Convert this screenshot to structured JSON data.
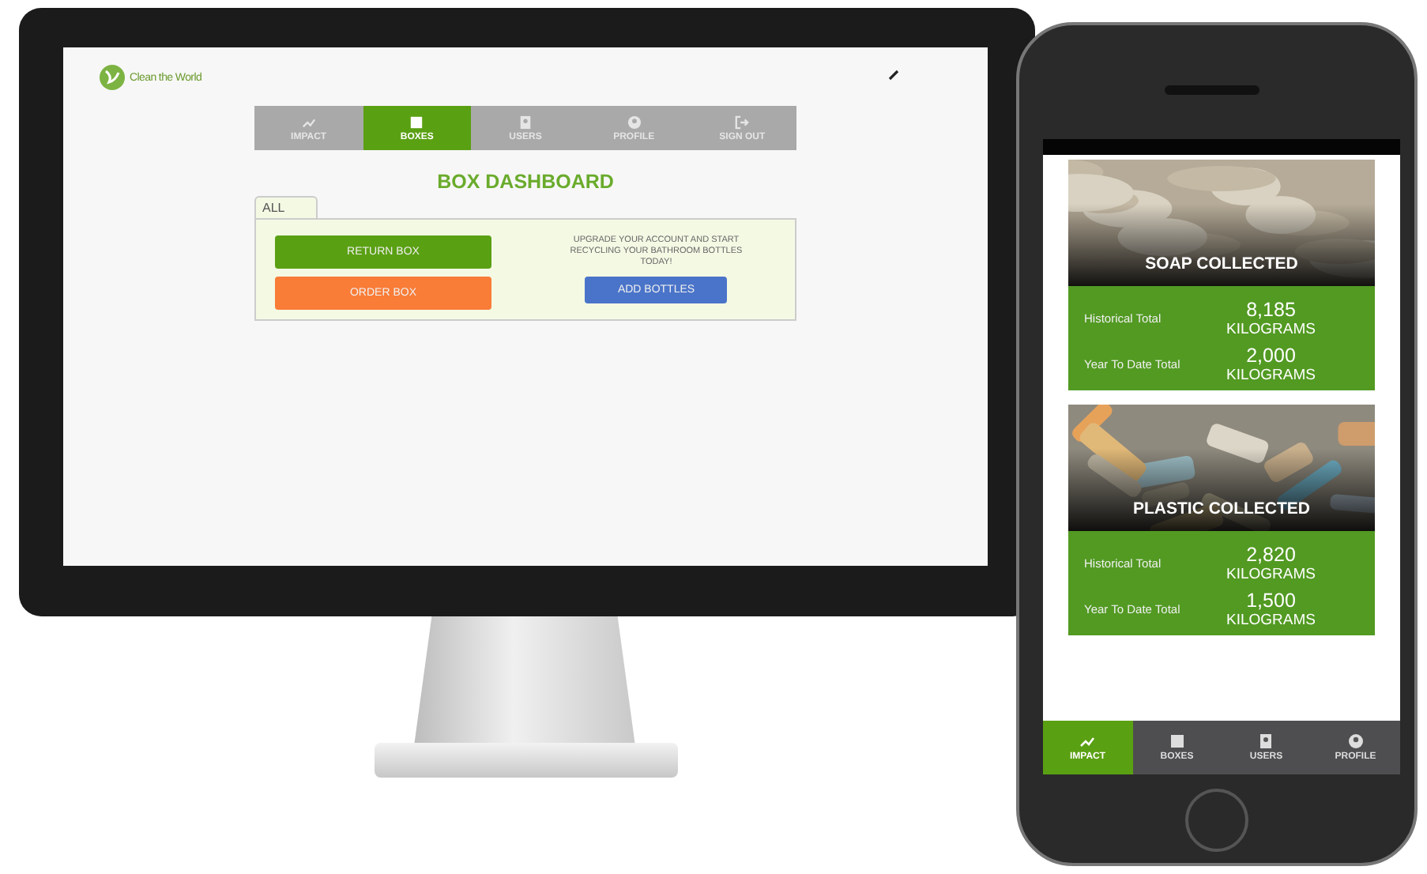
{
  "desktop": {
    "logo": "Clean the World",
    "tabs": [
      {
        "label": "IMPACT",
        "kind": "chart",
        "selected": false
      },
      {
        "label": "BOXES",
        "kind": "box",
        "selected": true
      },
      {
        "label": "USERS",
        "kind": "user",
        "selected": false
      },
      {
        "label": "PROFILE",
        "kind": "profile",
        "selected": false
      },
      {
        "label": "SIGN OUT",
        "kind": "signout",
        "selected": false
      }
    ],
    "heading": "BOX DASHBOARD",
    "filter_tabs": [
      {
        "label": "ALL",
        "selected": true
      }
    ],
    "buttons": [
      {
        "label": "RETURN BOX",
        "kind": "green"
      },
      {
        "label": "ORDER BOX",
        "kind": "orange"
      }
    ],
    "promo": "UPGRADE YOUR ACCOUNT AND START RECYCLING YOUR BATHROOM BOTTLES TODAY!",
    "promo_button": {
      "label": "ADD BOTTLES",
      "kind": "blue"
    }
  },
  "phone": {
    "cards": [
      {
        "title": "SOAP COLLECTED",
        "kind": "soap",
        "rows": [
          {
            "label": "Historical Total",
            "value": "8,185",
            "unit": "KILOGRAMS"
          },
          {
            "label": "Year To Date Total",
            "value": "2,000",
            "unit": "KILOGRAMS"
          }
        ]
      },
      {
        "title": "PLASTIC COLLECTED",
        "kind": "plastic",
        "rows": [
          {
            "label": "Historical Total",
            "value": "2,820",
            "unit": "KILOGRAMS"
          },
          {
            "label": "Year To Date Total",
            "value": "1,500",
            "unit": "KILOGRAMS"
          }
        ]
      }
    ],
    "nav": [
      {
        "label": "IMPACT",
        "kind": "chart",
        "selected": true
      },
      {
        "label": "BOXES",
        "kind": "box",
        "selected": false
      },
      {
        "label": "USERS",
        "kind": "user",
        "selected": false
      },
      {
        "label": "PROFILE",
        "kind": "profile",
        "selected": false
      }
    ]
  }
}
